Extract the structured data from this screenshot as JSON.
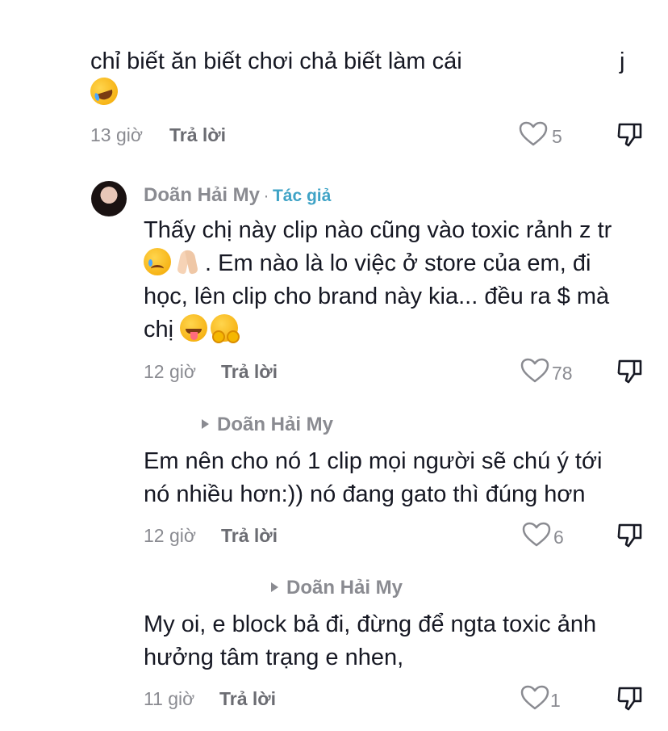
{
  "comments": [
    {
      "text_line1": "chỉ biết ăn biết chơi chả biết làm cái",
      "text_line1_tail": "j",
      "emoji": "rolling-laughing-emoji",
      "time": "13 giờ",
      "reply_label": "Trả lời",
      "likes": "5"
    },
    {
      "username": "Doãn Hải My",
      "separator": "·",
      "author_badge": "Tác giả",
      "text_line1": "Thấy chị này clip nào cũng vào toxic rảnh z tr",
      "text_line2": ". Em nào là lo việc ở store của em, đi",
      "text_line3": "học, lên clip cho brand này kia... đều ra $ mà",
      "text_line4": "chị",
      "emojis": [
        "crying-face-emoji",
        "folded-hands-emoji",
        "tongue-face-emoji",
        "hugging-face-emoji"
      ],
      "time": "12 giờ",
      "reply_label": "Trả lời",
      "likes": "78"
    },
    {
      "reply_to": "Doãn Hải My",
      "text_line1": "Em nên cho nó 1 clip mọi người sẽ chú ý tới",
      "text_line2": "nó nhiều hơn:)) nó đang gato thì đúng hơn",
      "time": "12 giờ",
      "reply_label": "Trả lời",
      "likes": "6"
    },
    {
      "reply_to": "Doãn Hải My",
      "text_line1": "My oi, e block bả đi, đừng để ngta toxic ảnh",
      "text_line2": "hưởng tâm trạng e nhen,",
      "time": "11 giờ",
      "reply_label": "Trả lời",
      "likes": "1"
    }
  ],
  "icons": {
    "like": "heart-outline-icon",
    "dislike": "thumbs-down-icon",
    "reply_arrow": "triangle-right-icon"
  },
  "colors": {
    "text": "#161823",
    "meta": "#8a8b91",
    "author_badge": "#3fa3c6"
  }
}
